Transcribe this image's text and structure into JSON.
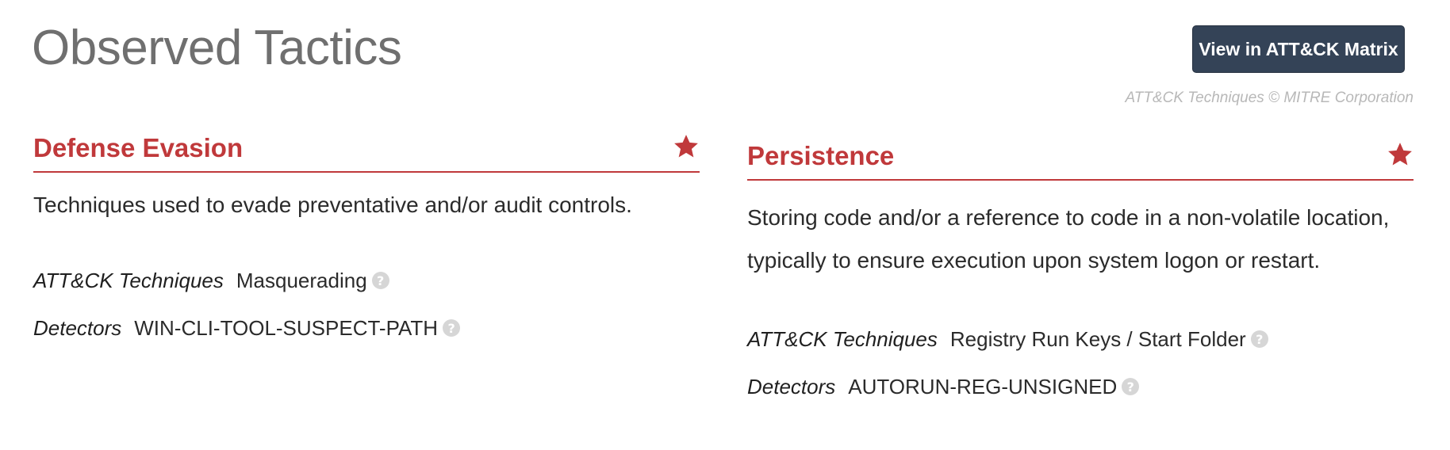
{
  "page": {
    "title": "Observed Tactics",
    "matrix_button_label": "View in ATT&CK Matrix",
    "copyright": "ATT&CK Techniques © MITRE Corporation"
  },
  "colors": {
    "accent": "#c0393b",
    "button_bg": "#344357",
    "help_icon": "#d6d6d6"
  },
  "tactics": [
    {
      "name": "Defense Evasion",
      "description": "Techniques used to evade preventative and/or audit controls.",
      "techniques_label": "ATT&CK Techniques",
      "techniques_value": "Masquerading",
      "detectors_label": "Detectors",
      "detectors_value": "WIN-CLI-TOOL-SUSPECT-PATH",
      "icon": "star-icon"
    },
    {
      "name": "Persistence",
      "description": "Storing code and/or a reference to code in a non-volatile location, typically to ensure execution upon system logon or restart.",
      "techniques_label": "ATT&CK Techniques",
      "techniques_value": "Registry Run Keys / Start Folder",
      "detectors_label": "Detectors",
      "detectors_value": "AUTORUN-REG-UNSIGNED",
      "icon": "star-icon"
    }
  ]
}
